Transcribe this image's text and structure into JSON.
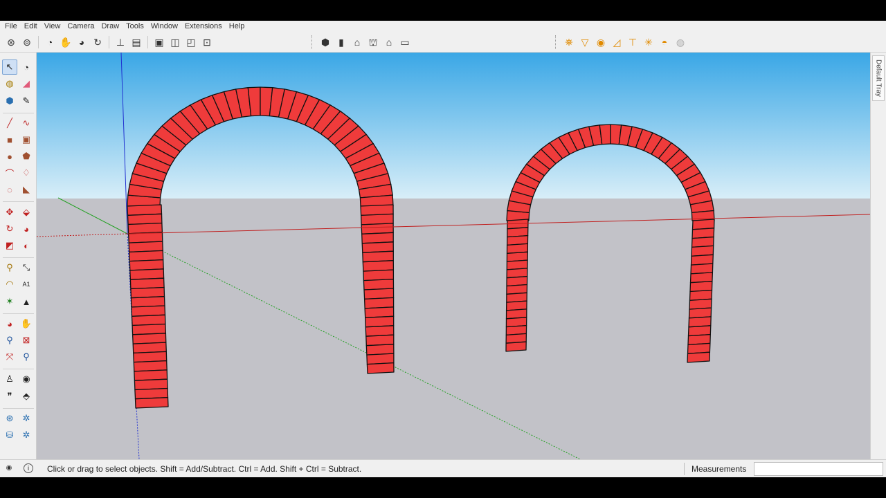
{
  "menubar": {
    "items": [
      "File",
      "Edit",
      "View",
      "Camera",
      "Draw",
      "Tools",
      "Window",
      "Extensions",
      "Help"
    ]
  },
  "toolbars": {
    "getting_started": [
      "model-info-icon",
      "outliner-icon",
      "orbit-icon",
      "pan-icon",
      "zoom-icon",
      "zoom-extents-icon",
      "section-plane-icon",
      "section-fill-icon",
      "xray-icon",
      "back-edges-icon",
      "wireframe-icon",
      "lock-icon"
    ],
    "views": [
      "iso-view-icon",
      "top-view-icon",
      "front-view-icon",
      "right-view-icon",
      "back-view-icon",
      "left-view-icon"
    ],
    "styles": [
      "shadow-settings-icon",
      "fog-icon",
      "sun-icon",
      "angle-icon",
      "tape-icon",
      "axes-icon",
      "sandbox-icon",
      "disabled-icon"
    ]
  },
  "left_toolbar": {
    "tools": [
      "select-icon",
      "orbit-tool-icon",
      "paint-bucket-icon",
      "eraser-icon",
      "component-icon",
      "pencil-icon",
      "line-icon",
      "freehand-icon",
      "rectangle-icon",
      "rotated-rectangle-icon",
      "circle-icon",
      "polygon-icon",
      "arc-icon",
      "two-point-arc-icon",
      "pie-icon",
      "three-point-arc-icon",
      "move-icon",
      "push-pull-icon",
      "rotate-icon",
      "follow-me-icon",
      "scale-icon",
      "offset-icon",
      "tape-measure-icon",
      "dimension-icon",
      "protractor-icon",
      "text-icon",
      "axes-tool-icon",
      "3d-text-icon",
      "orbit-nav-icon",
      "pan-nav-icon",
      "zoom-nav-icon",
      "zoom-window-icon",
      "zoom-extents-nav-icon",
      "previous-view-icon",
      "position-camera-icon",
      "look-around-icon",
      "walk-icon",
      "section-plane-tool-icon",
      "3d-warehouse-icon",
      "extension-warehouse-icon",
      "layout-icon",
      "extension-manager-icon"
    ],
    "active_tool": "select-icon"
  },
  "tray": {
    "label": "Default Tray"
  },
  "status": {
    "hint": "Click or drag to select objects. Shift = Add/Subtract. Ctrl = Add. Shift + Ctrl = Subtract.",
    "measurements_label": "Measurements",
    "measurements_value": ""
  },
  "colors": {
    "sky_top": "#3aa7e6",
    "sky_bottom": "#d8eef8",
    "ground": "#c2c2c8",
    "brick": "#ef3b3b",
    "axis_red": "#c02020",
    "axis_green": "#21a021",
    "axis_blue": "#2030d0"
  }
}
